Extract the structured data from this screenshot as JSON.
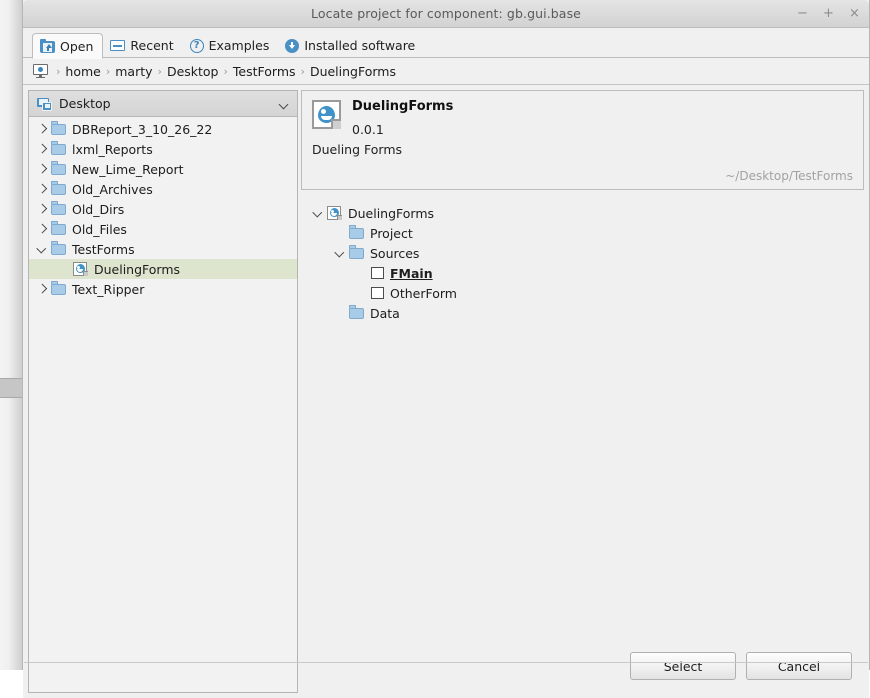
{
  "window": {
    "title": "Locate project for component: gb.gui.base",
    "controls": [
      {
        "name": "minimize",
        "glyph": "−"
      },
      {
        "name": "maximize",
        "glyph": "+"
      },
      {
        "name": "close",
        "glyph": "×"
      }
    ]
  },
  "tabs": [
    {
      "label": "Open",
      "icon": "open-folder-icon",
      "active": true
    },
    {
      "label": "Recent",
      "icon": "recent-icon",
      "active": false
    },
    {
      "label": "Examples",
      "icon": "question-circle-icon",
      "active": false
    },
    {
      "label": "Installed software",
      "icon": "download-circle-icon",
      "active": false
    }
  ],
  "breadcrumb": {
    "root_icon": "computer-icon",
    "items": [
      "home",
      "marty",
      "Desktop",
      "TestForms",
      "DuelingForms"
    ],
    "separator": "›"
  },
  "sidebar": {
    "header": {
      "label": "Desktop",
      "icon": "desktop-icon",
      "chevron": "chevron-down-icon"
    },
    "items": [
      {
        "label": "DBReport_3_10_26_22",
        "icon": "folder",
        "state": "collapsed",
        "indent": 1,
        "selected": false
      },
      {
        "label": "lxml_Reports",
        "icon": "folder",
        "state": "collapsed",
        "indent": 1,
        "selected": false
      },
      {
        "label": "New_Lime_Report",
        "icon": "folder",
        "state": "collapsed",
        "indent": 1,
        "selected": false
      },
      {
        "label": "Old_Archives",
        "icon": "folder",
        "state": "collapsed",
        "indent": 1,
        "selected": false
      },
      {
        "label": "Old_Dirs",
        "icon": "folder",
        "state": "collapsed",
        "indent": 1,
        "selected": false
      },
      {
        "label": "Old_Files",
        "icon": "folder",
        "state": "collapsed",
        "indent": 1,
        "selected": false
      },
      {
        "label": "TestForms",
        "icon": "folder",
        "state": "expanded",
        "indent": 1,
        "selected": false
      },
      {
        "label": "DuelingForms",
        "icon": "gambas",
        "state": "leaf",
        "indent": 2,
        "selected": true
      },
      {
        "label": "Text_Ripper",
        "icon": "folder",
        "state": "collapsed",
        "indent": 1,
        "selected": false
      }
    ],
    "selection_color": "#dde5cf"
  },
  "project_info": {
    "icon": "gambas-project-icon",
    "name": "DuelingForms",
    "version": "0.0.1",
    "description": "Dueling Forms",
    "path": "~/Desktop/TestForms"
  },
  "project_tree": [
    {
      "label": "DuelingForms",
      "icon": "gambas",
      "state": "expanded",
      "indent": 0,
      "bold": false
    },
    {
      "label": "Project",
      "icon": "folder",
      "state": "leaf",
      "indent": 1,
      "bold": false
    },
    {
      "label": "Sources",
      "icon": "folder",
      "state": "expanded",
      "indent": 1,
      "bold": false
    },
    {
      "label": "FMain",
      "icon": "form",
      "state": "leaf",
      "indent": 2,
      "bold": true
    },
    {
      "label": "OtherForm",
      "icon": "form",
      "state": "leaf",
      "indent": 2,
      "bold": false
    },
    {
      "label": "Data",
      "icon": "folder",
      "state": "leaf",
      "indent": 1,
      "bold": false
    }
  ],
  "footer": {
    "select_label": "Select",
    "cancel_label": "Cancel"
  }
}
